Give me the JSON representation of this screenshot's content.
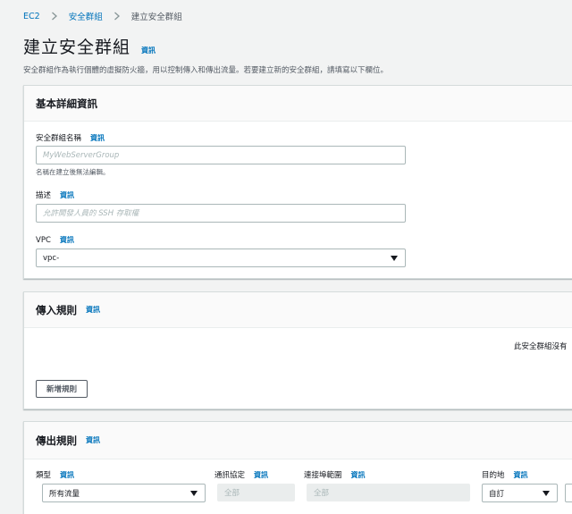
{
  "breadcrumb": {
    "items": [
      "EC2",
      "安全群組",
      "建立安全群組"
    ]
  },
  "header": {
    "title": "建立安全群組",
    "info": "資訊",
    "description": "安全群組作為執行個體的虛擬防火牆，用以控制傳入和傳出流量。若要建立新的安全群組，請填寫以下欄位。"
  },
  "basic_details": {
    "title": "基本詳細資訊",
    "info": "資訊",
    "name": {
      "label": "安全群組名稱",
      "info": "資訊",
      "placeholder": "MyWebServerGroup",
      "hint": "名稱在建立後無法編輯。"
    },
    "description": {
      "label": "描述",
      "info": "資訊",
      "placeholder": "允許開發人員的 SSH 存取權"
    },
    "vpc": {
      "label": "VPC",
      "info": "資訊",
      "value": "vpc-"
    }
  },
  "inbound": {
    "title": "傳入規則",
    "info": "資訊",
    "empty_text": "此安全群組沒有",
    "add_rule": "新增規則"
  },
  "outbound": {
    "title": "傳出規則",
    "info": "資訊",
    "type": {
      "label": "類型",
      "info": "資訊",
      "value": "所有流量"
    },
    "protocol": {
      "label": "通訊協定",
      "info": "資訊",
      "value": "全部"
    },
    "port_range": {
      "label": "連接埠範圍",
      "info": "資訊",
      "value": "全部"
    },
    "destination": {
      "label": "目的地",
      "info": "資訊",
      "value": "自訂"
    }
  },
  "colors": {
    "link": "#0073bb",
    "page_background": "#f2f3f3",
    "panel_header": "#fafafa",
    "text": "#16191f",
    "muted": "#545b64"
  },
  "icons": {
    "breadcrumb_separator": "chevron-right-icon",
    "select_caret": "caret-down-icon"
  }
}
